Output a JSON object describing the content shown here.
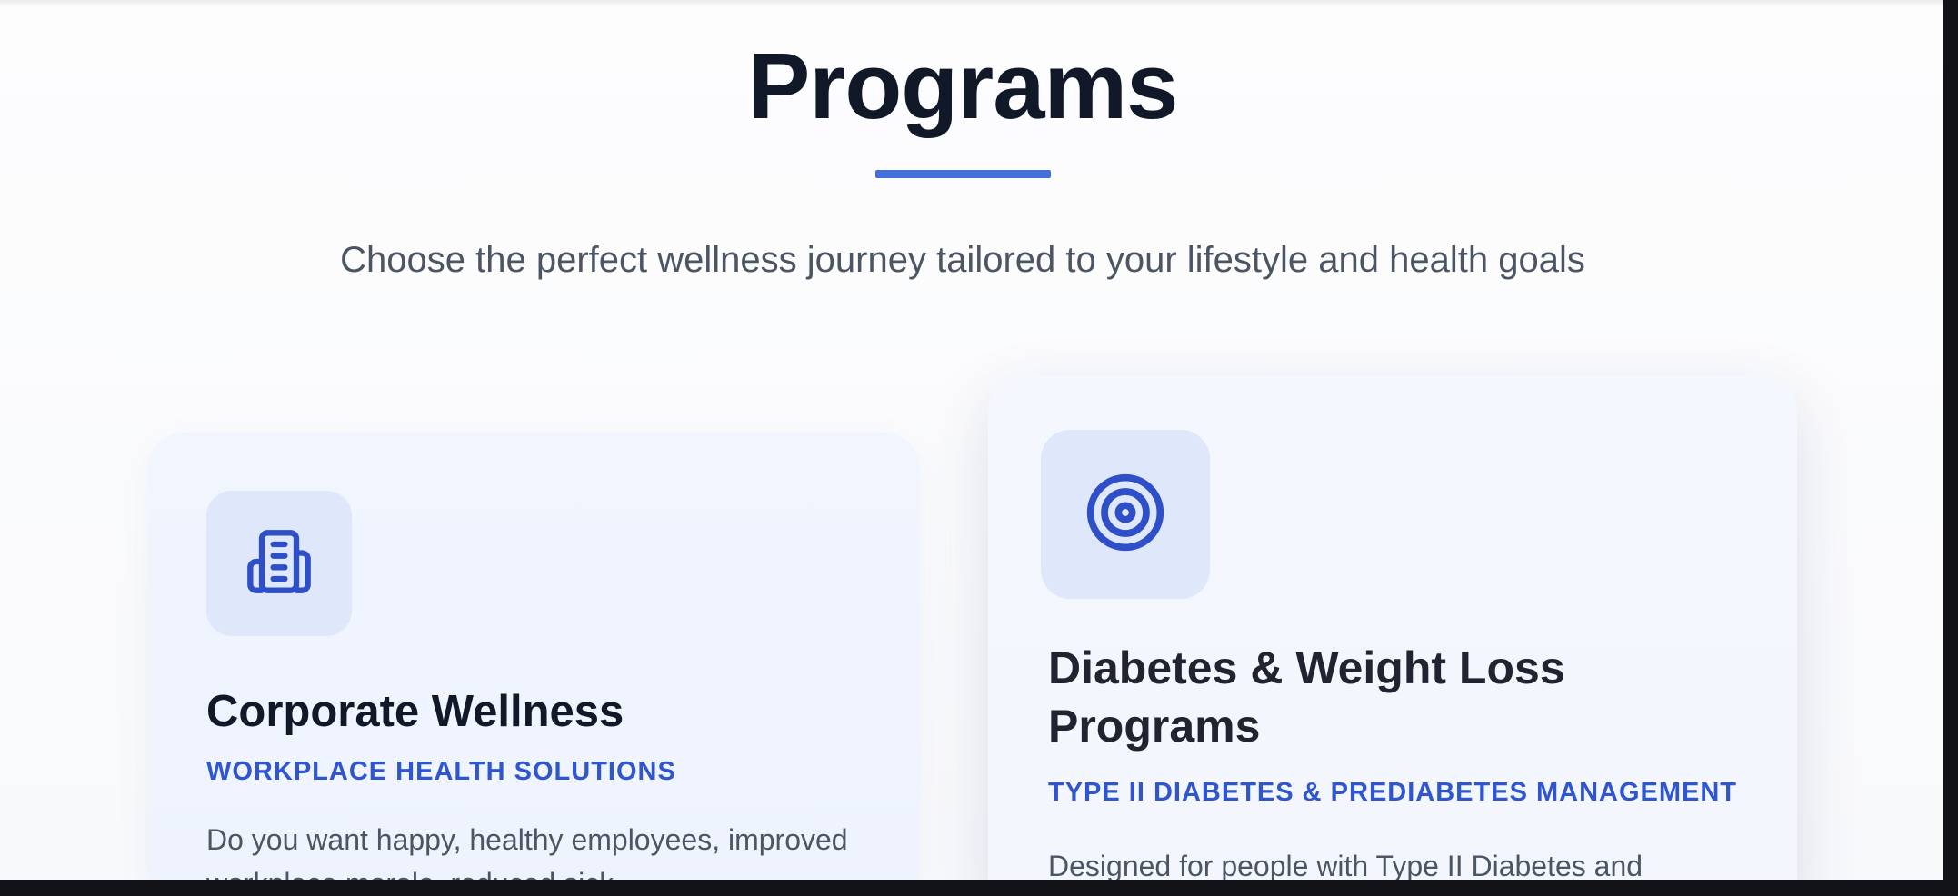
{
  "section": {
    "title": "Programs",
    "subtitle": "Choose the perfect wellness journey tailored to your lifestyle and health goals",
    "accent_color": "#4270dc"
  },
  "programs": [
    {
      "icon": "building-icon",
      "title": "Corporate Wellness",
      "tag": "WORKPLACE HEALTH SOLUTIONS",
      "description": "Do you want happy, healthy employees, improved workplace morale, reduced sick"
    },
    {
      "icon": "target-icon",
      "title": "Diabetes & Weight Loss Programs",
      "tag": "TYPE II DIABETES & PREDIABETES MANAGEMENT",
      "description": "Designed for people with Type II Diabetes and"
    }
  ],
  "colors": {
    "heading": "#111827",
    "tag": "#2f56cf",
    "icon": "#2f4fc9",
    "icon_bg": "#dfe8fb"
  }
}
